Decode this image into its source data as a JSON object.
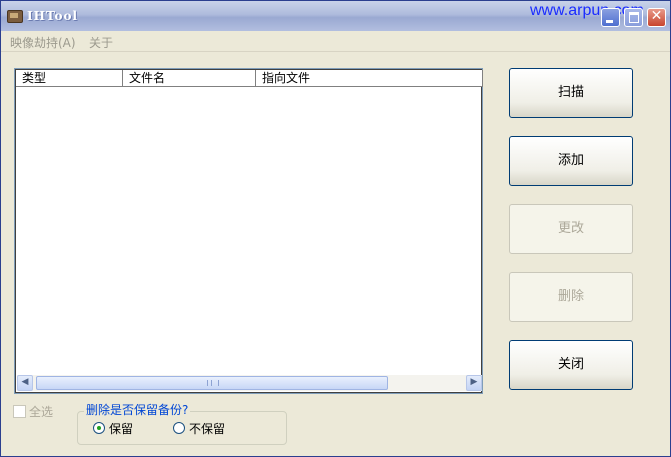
{
  "window": {
    "title": "IHTool",
    "watermark": "www.arpun.com"
  },
  "menu": [
    {
      "label": "映像劫持(A)"
    },
    {
      "label": "关于"
    }
  ],
  "list": {
    "columns": [
      "类型",
      "文件名",
      "指向文件"
    ],
    "rows": []
  },
  "buttons": {
    "scan": "扫描",
    "add": "添加",
    "modify": "更改",
    "delete": "删除",
    "close": "关闭"
  },
  "select_all": {
    "label": "全选",
    "checked": false,
    "enabled": false
  },
  "backup_group": {
    "title": "删除是否保留备份?",
    "options": [
      {
        "label": "保留",
        "selected": true
      },
      {
        "label": "不保留",
        "selected": false
      }
    ]
  },
  "colors": {
    "accent": "#0046d5",
    "watermark": "#1a2cff"
  }
}
